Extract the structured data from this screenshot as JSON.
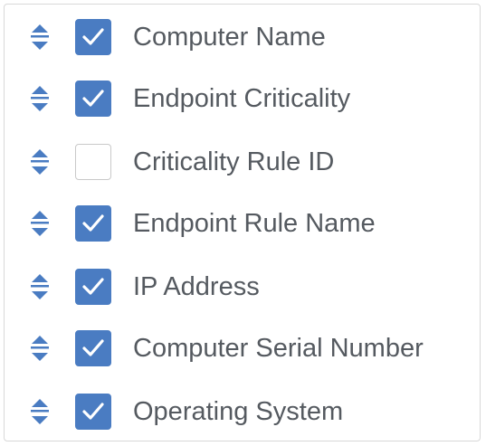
{
  "colors": {
    "accent": "#4a7cc2",
    "text": "#555a60",
    "border": "#d8d8d8"
  },
  "columns": [
    {
      "label": "Computer Name",
      "checked": true,
      "drag_icon": "sort-arrows-icon"
    },
    {
      "label": "Endpoint Criticality",
      "checked": true,
      "drag_icon": "sort-arrows-icon"
    },
    {
      "label": "Criticality Rule ID",
      "checked": false,
      "drag_icon": "sort-arrows-icon"
    },
    {
      "label": "Endpoint Rule Name",
      "checked": true,
      "drag_icon": "sort-arrows-icon"
    },
    {
      "label": "IP Address",
      "checked": true,
      "drag_icon": "sort-arrows-icon"
    },
    {
      "label": "Computer Serial Number",
      "checked": true,
      "drag_icon": "sort-arrows-icon"
    },
    {
      "label": "Operating System",
      "checked": true,
      "drag_icon": "sort-arrows-icon"
    }
  ]
}
